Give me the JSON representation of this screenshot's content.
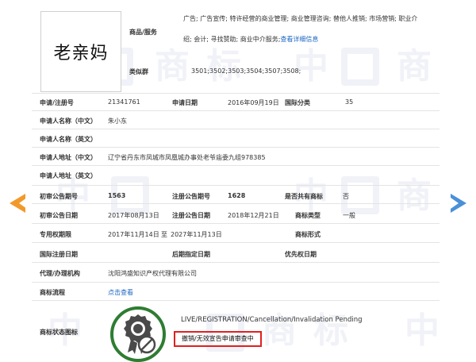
{
  "trademark": {
    "logo_text": "老亲妈",
    "goods_services_label": "商品/服务",
    "goods_services_line1": "广告; 广告宣传; 特许经营的商业管理; 商业管理咨询; 替他人推销; 市场营销; 职业介",
    "goods_services_line2_text": "绍; 会计; 寻找赞助; 商业中介服务;",
    "goods_services_more_link": "查看详细信息",
    "similar_group_label": "类似群",
    "similar_group_value": "3501;3502;3503;3504;3507;3508;"
  },
  "fields": {
    "reg_no_label": "申请/注册号",
    "reg_no_value": "21341761",
    "app_date_label": "申请日期",
    "app_date_value": "2016年09月19日",
    "intl_class_label": "国际分类",
    "intl_class_value": "35",
    "applicant_cn_label": "申请人名称（中文）",
    "applicant_cn_value": "朱小东",
    "applicant_en_label": "申请人名称（英文）",
    "address_cn_label": "申请人地址（中文）",
    "address_cn_value": "辽宁省丹东市凤城市凤凰城办事处老爷庙委九组978385",
    "address_en_label": "申请人地址（英文）",
    "prelim_issue_label": "初审公告期号",
    "prelim_issue_value": "1563",
    "reg_issue_label": "注册公告期号",
    "reg_issue_value": "1628",
    "shared_label": "是否共有商标",
    "shared_value": "否",
    "prelim_date_label": "初审公告日期",
    "prelim_date_value": "2017年08月13日",
    "reg_date_label": "注册公告日期",
    "reg_date_value": "2018年12月21日",
    "tm_type_label": "商标类型",
    "tm_type_value": "一般",
    "exclusive_label": "专用权期限",
    "exclusive_start": "2017年11月14日",
    "exclusive_to": "至",
    "exclusive_end": "2027年11月13日",
    "tm_form_label": "商标形式",
    "intl_reg_date_label": "国际注册日期",
    "later_designation_label": "后期指定日期",
    "priority_date_label": "优先权日期",
    "agent_label": "代理/办理机构",
    "agent_value": "沈阳鸿盛知识产权代理有限公司",
    "process_label": "商标流程",
    "process_link": "点击查看",
    "status_label": "商标状态图标"
  },
  "status": {
    "en": "LIVE/REGISTRATION/Cancellation/Invalidation Pending",
    "cn": "撤销/无效宣告申请审查中"
  },
  "icons": {
    "prev": "chevron-left-icon",
    "next": "chevron-right-icon",
    "status": "award-badge-icon"
  },
  "colors": {
    "link": "#1a66c2",
    "prev_arrow": "#f19a2b",
    "next_arrow": "#4a90d9",
    "status_green": "#2e7d32",
    "status_box_border": "#e02020"
  }
}
